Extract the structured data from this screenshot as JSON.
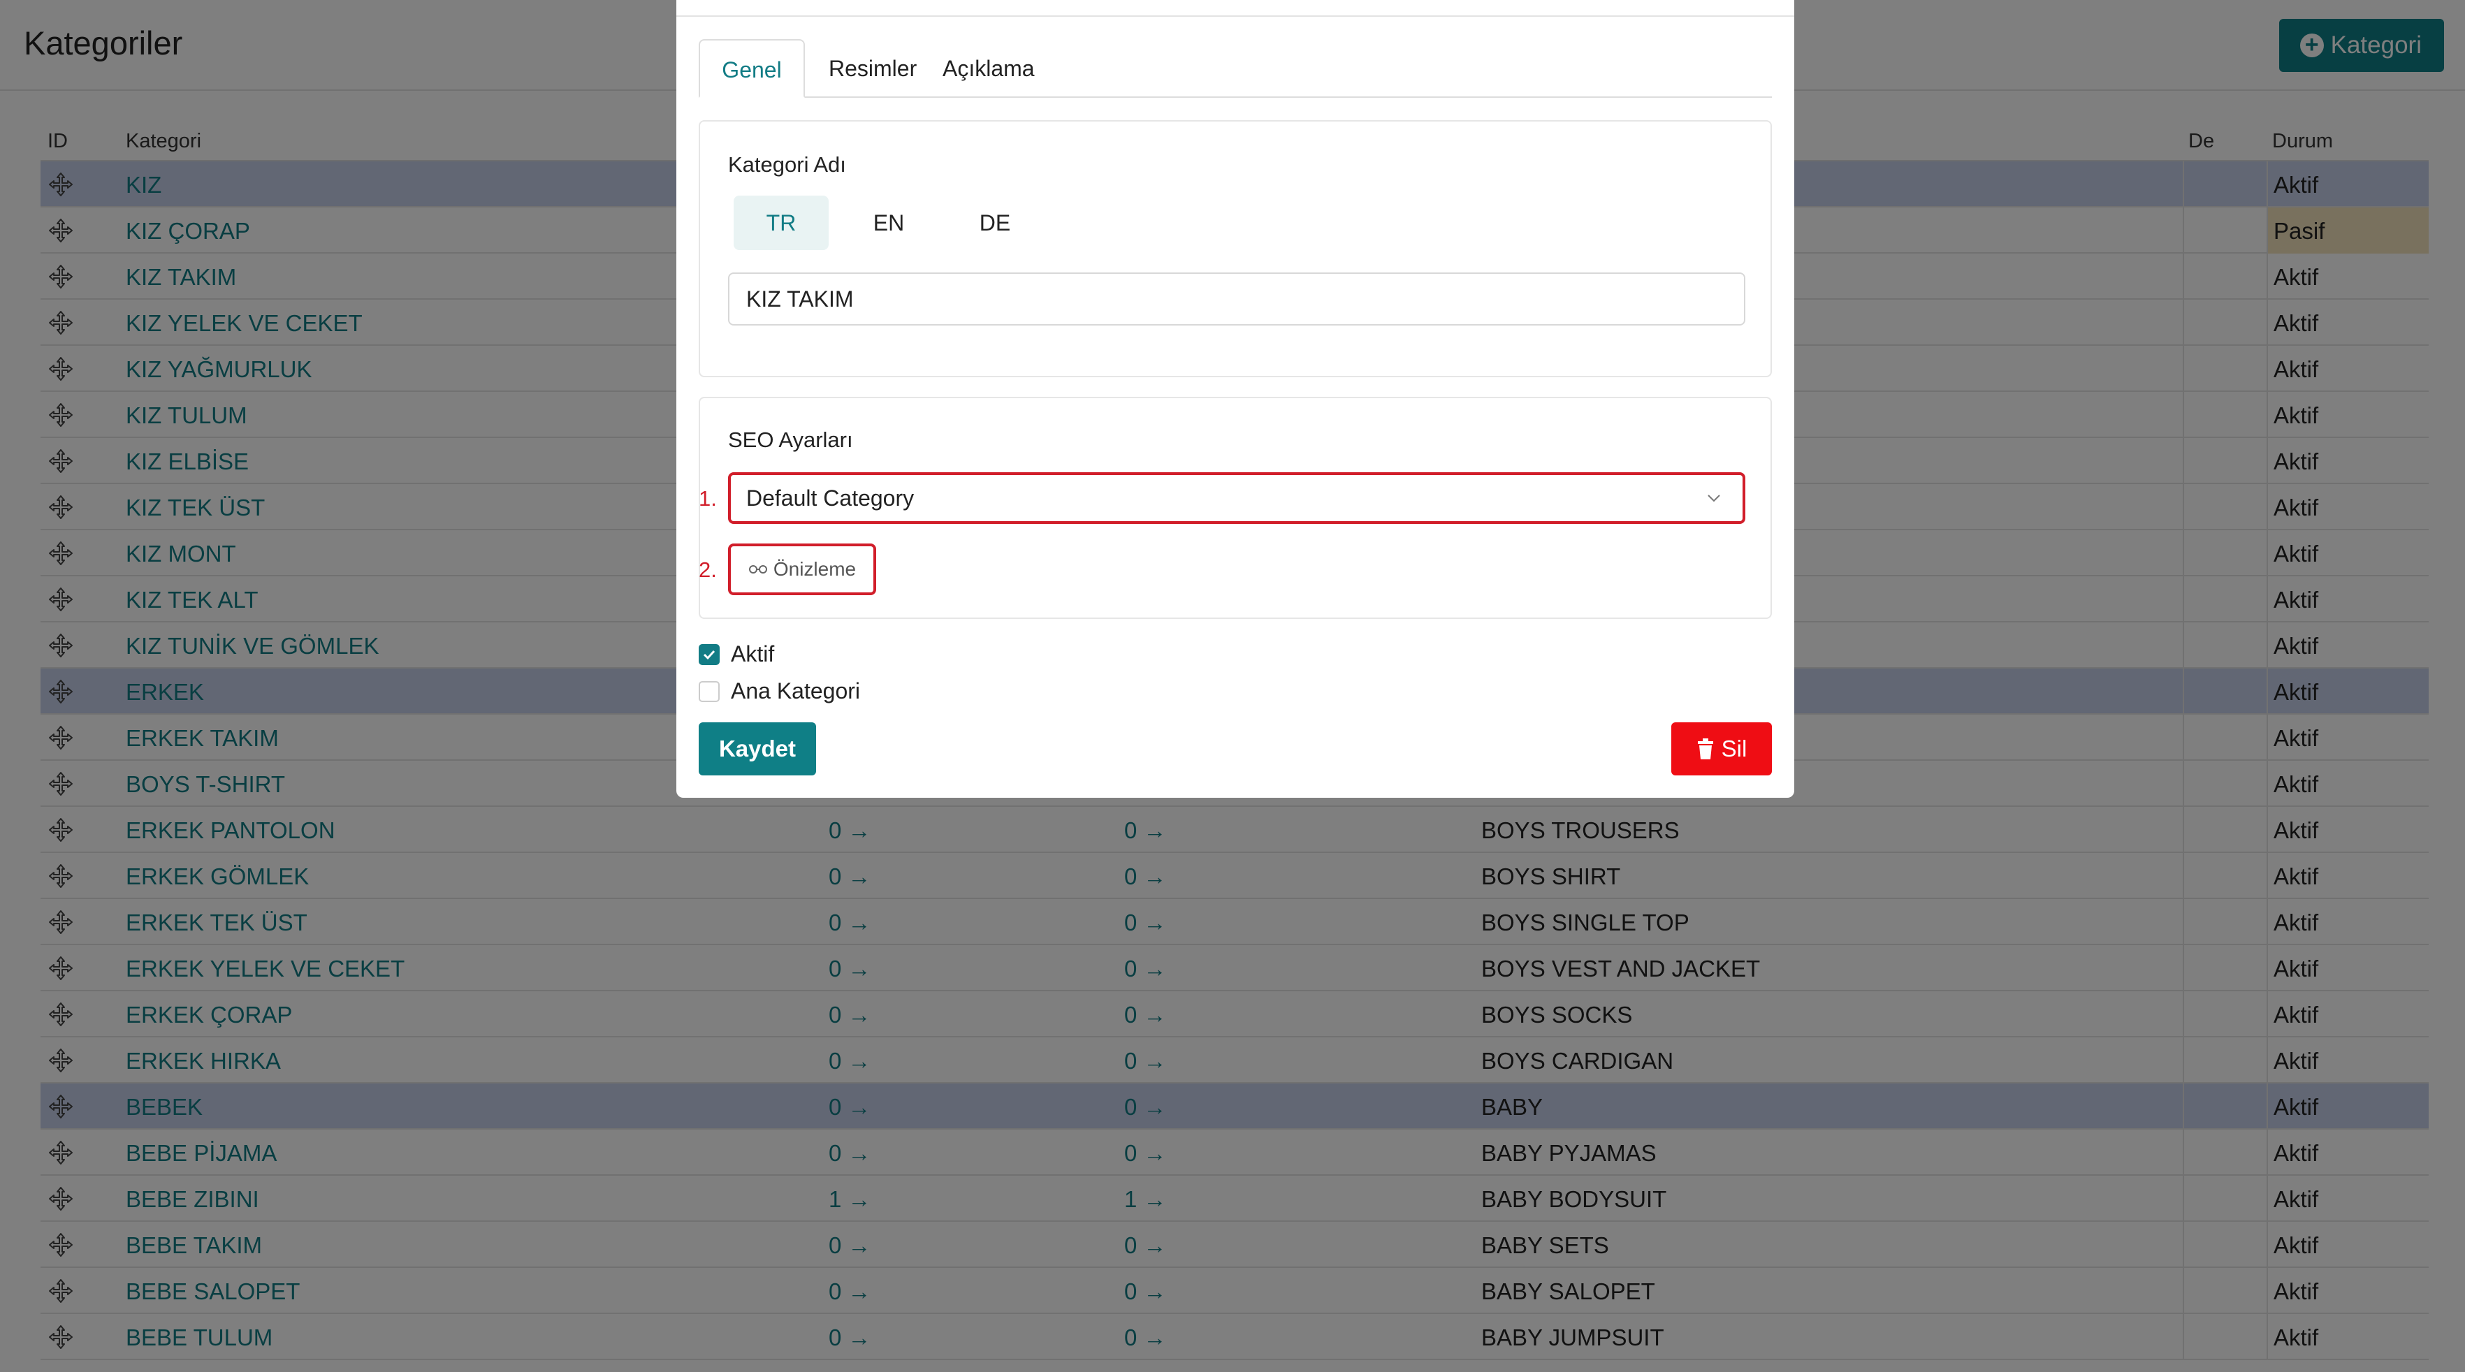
{
  "page": {
    "title": "Kategoriler",
    "add_button_label": "Kategori",
    "colors": {
      "accent": "#0f7f86",
      "danger": "#ef0d14",
      "highlight_row": "#c5cfe8",
      "pasif_bg": "#f3e2bc",
      "annotation": "#d11e2a"
    }
  },
  "table": {
    "headers": {
      "id": "ID",
      "category": "Kategori",
      "de": "De",
      "status": "Durum"
    },
    "rows": [
      {
        "name": "KIZ",
        "c3": "",
        "c4": "",
        "c5": "",
        "status": "Aktif",
        "highlight": true
      },
      {
        "name": "KIZ ÇORAP",
        "c3": "",
        "c4": "",
        "c5": "",
        "status": "Pasif",
        "highlight": false
      },
      {
        "name": "KIZ TAKIM",
        "c3": "",
        "c4": "",
        "c5": "",
        "status": "Aktif",
        "highlight": false
      },
      {
        "name": "KIZ YELEK VE CEKET",
        "c3": "",
        "c4": "",
        "c5": "",
        "status": "Aktif",
        "highlight": false
      },
      {
        "name": "KIZ YAĞMURLUK",
        "c3": "",
        "c4": "",
        "c5": "",
        "status": "Aktif",
        "highlight": false
      },
      {
        "name": "KIZ TULUM",
        "c3": "",
        "c4": "",
        "c5": "",
        "status": "Aktif",
        "highlight": false
      },
      {
        "name": "KIZ ELBİSE",
        "c3": "",
        "c4": "",
        "c5": "",
        "status": "Aktif",
        "highlight": false
      },
      {
        "name": "KIZ TEK ÜST",
        "c3": "",
        "c4": "",
        "c5": "",
        "status": "Aktif",
        "highlight": false
      },
      {
        "name": "KIZ MONT",
        "c3": "",
        "c4": "",
        "c5": "",
        "status": "Aktif",
        "highlight": false
      },
      {
        "name": "KIZ TEK ALT",
        "c3": "",
        "c4": "",
        "c5": "",
        "status": "Aktif",
        "highlight": false
      },
      {
        "name": "KIZ TUNİK VE GÖMLEK",
        "c3": "",
        "c4": "",
        "c5": "",
        "status": "Aktif",
        "highlight": false
      },
      {
        "name": "ERKEK",
        "c3": "",
        "c4": "",
        "c5": "",
        "status": "Aktif",
        "highlight": true
      },
      {
        "name": "ERKEK TAKIM",
        "c3": "",
        "c4": "",
        "c5": "",
        "status": "Aktif",
        "highlight": false
      },
      {
        "name": "BOYS T-SHIRT",
        "c3": "",
        "c4": "",
        "c5": "",
        "status": "Aktif",
        "highlight": false
      },
      {
        "name": "ERKEK PANTOLON",
        "c3": "0 →",
        "c4": "0 →",
        "c5": "BOYS TROUSERS",
        "status": "Aktif",
        "highlight": false
      },
      {
        "name": "ERKEK GÖMLEK",
        "c3": "0 →",
        "c4": "0 →",
        "c5": "BOYS SHIRT",
        "status": "Aktif",
        "highlight": false
      },
      {
        "name": "ERKEK TEK ÜST",
        "c3": "0 →",
        "c4": "0 →",
        "c5": "BOYS SINGLE TOP",
        "status": "Aktif",
        "highlight": false
      },
      {
        "name": "ERKEK YELEK VE CEKET",
        "c3": "0 →",
        "c4": "0 →",
        "c5": "BOYS VEST AND JACKET",
        "status": "Aktif",
        "highlight": false
      },
      {
        "name": "ERKEK ÇORAP",
        "c3": "0 →",
        "c4": "0 →",
        "c5": "BOYS SOCKS",
        "status": "Aktif",
        "highlight": false
      },
      {
        "name": "ERKEK HIRKA",
        "c3": "0 →",
        "c4": "0 →",
        "c5": "BOYS CARDIGAN",
        "status": "Aktif",
        "highlight": false
      },
      {
        "name": "BEBEK",
        "c3": "0 →",
        "c4": "0 →",
        "c5": "BABY",
        "status": "Aktif",
        "highlight": true
      },
      {
        "name": "BEBE PİJAMA",
        "c3": "0 →",
        "c4": "0 →",
        "c5": "BABY PYJAMAS",
        "status": "Aktif",
        "highlight": false
      },
      {
        "name": "BEBE ZIBINI",
        "c3": "1 →",
        "c4": "1 →",
        "c5": "BABY BODYSUIT",
        "status": "Aktif",
        "highlight": false
      },
      {
        "name": "BEBE TAKIM",
        "c3": "0 →",
        "c4": "0 →",
        "c5": "BABY SETS",
        "status": "Aktif",
        "highlight": false
      },
      {
        "name": "BEBE SALOPET",
        "c3": "0 →",
        "c4": "0 →",
        "c5": "BABY SALOPET",
        "status": "Aktif",
        "highlight": false
      },
      {
        "name": "BEBE TULUM",
        "c3": "0 →",
        "c4": "0 →",
        "c5": "BABY JUMPSUIT",
        "status": "Aktif",
        "highlight": false
      }
    ]
  },
  "modal": {
    "tabs": {
      "genel": "Genel",
      "resimler": "Resimler",
      "aciklama": "Açıklama",
      "active": "genel"
    },
    "name_section": {
      "title": "Kategori Adı",
      "languages": [
        "TR",
        "EN",
        "DE"
      ],
      "active_language": "TR",
      "value": "KIZ TAKIM"
    },
    "seo_section": {
      "title": "SEO Ayarları",
      "selected": "Default Category",
      "preview_label": "Önizleme",
      "marker_1": "1.",
      "marker_2": "2."
    },
    "checkboxes": {
      "aktif": {
        "label": "Aktif",
        "checked": true
      },
      "ana_kategori": {
        "label": "Ana Kategori",
        "checked": false
      }
    },
    "save_label": "Kaydet",
    "delete_label": "Sil"
  },
  "icons": {
    "row_handle": "move-icon",
    "add": "plus-circle-icon",
    "select": "chevron-down-icon",
    "preview": "glasses-icon",
    "delete": "trash-icon",
    "check": "checkmark-icon"
  }
}
